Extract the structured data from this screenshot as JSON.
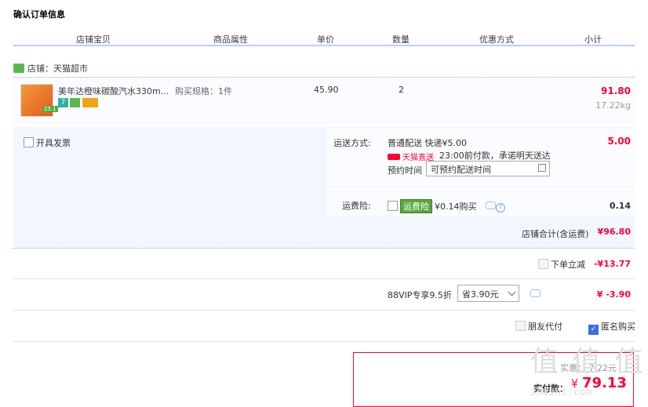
{
  "page": {
    "title": "确认订单信息"
  },
  "columns": [
    "店铺宝贝",
    "商品属性",
    "单价",
    "数量",
    "优惠方式",
    "小计"
  ],
  "shop": {
    "label": "店铺：天猫超市"
  },
  "product": {
    "name": "美年达橙味碳酸汽水330m...",
    "spec": "购买规格：1件",
    "price": "45.90",
    "qty": "2",
    "subtotal": "91.80",
    "weight": "17.22kg",
    "thumb_badge": "25.1",
    "tags": [
      {
        "text": "7",
        "color": "#2fb0a5"
      },
      {
        "text": "",
        "color": "#5bb84d"
      },
      {
        "text": "",
        "color": "#f4a11a"
      }
    ]
  },
  "invoice": {
    "label": "开具发票"
  },
  "shipping": {
    "label": "运送方式:",
    "method": "普通配送 快递¥5.00",
    "tmall_label": "天猫直送",
    "promise": "23:00前付款，承诺明天送达",
    "appoint_label": "预约时间",
    "appoint_value": "可预约配送时间",
    "fee": "5.00"
  },
  "insurance": {
    "label": "运费险:",
    "badge": "运费险",
    "price": "¥0.14购买",
    "amount": "0.14"
  },
  "shop_total": {
    "label": "店铺合计(含运费)",
    "amount": "¥96.80"
  },
  "discount": {
    "label": "下单立减",
    "amount": "-¥13.77"
  },
  "vip": {
    "label": "88VIP专享9.5折",
    "select": "省3.90元",
    "amount": "¥ -3.90"
  },
  "options": {
    "friend_pay": "朋友代付",
    "anonymous": "匿名购买"
  },
  "pay": {
    "label": "实付款：",
    "currency": "¥",
    "amount": "79.13",
    "partial": "实惠：  7.22元"
  },
  "watermark": {
    "text": "值 值 值",
    "site": "zhizhi.com"
  },
  "colors": {
    "accent": "#ff0036",
    "border": "#b2d1ff"
  }
}
